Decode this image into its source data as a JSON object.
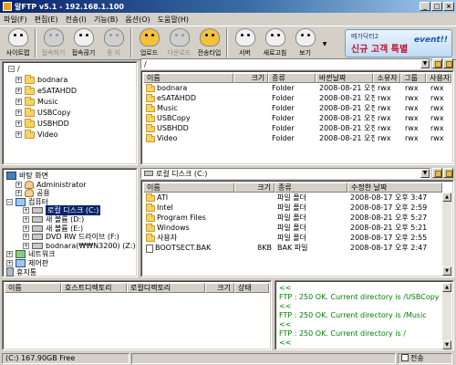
{
  "window": {
    "title": "알FTP v5.1 - 192.168.1.100"
  },
  "menu": [
    "파일(F)",
    "편집(E)",
    "전송(I)",
    "기능(B)",
    "옵션(O)",
    "도움말(H)"
  ],
  "toolbar": {
    "buttons": [
      {
        "label": "사이트맵",
        "color": "#f0f0f0",
        "enabled": true
      },
      {
        "label": "접속하기",
        "color": "#cfcfcf",
        "enabled": false
      },
      {
        "label": "접속끊기",
        "color": "#f0f0f0",
        "enabled": true
      },
      {
        "label": "중 지",
        "color": "#cfcfcf",
        "enabled": false
      },
      {
        "label": "업로드",
        "color": "#f3c13a",
        "enabled": true
      },
      {
        "label": "다운로드",
        "color": "#cfcfcf",
        "enabled": false
      },
      {
        "label": "전송타입",
        "color": "#f3c13a",
        "enabled": true
      },
      {
        "label": "서버",
        "color": "#f0f0f0",
        "enabled": true
      },
      {
        "label": "새로고침",
        "color": "#f0f0f0",
        "enabled": true
      },
      {
        "label": "보기",
        "color": "#f0f0f0",
        "enabled": true
      }
    ],
    "ad": {
      "top": "메가닥터2",
      "main": "신규 고객 특별",
      "event": "event!!"
    }
  },
  "remote_tree": {
    "items": [
      "/",
      "bodnara",
      "eSATAHDD",
      "Music",
      "USBCopy",
      "USBHDD",
      "Video"
    ]
  },
  "remote": {
    "path": "/",
    "columns": [
      "이름",
      "크기",
      "종류",
      "바뀐날짜",
      "소유자",
      "그룹",
      "사용자"
    ],
    "rows": [
      {
        "name": "bodnara",
        "size": "",
        "type": "Folder",
        "date": "2008-08-21 오전 ...",
        "owner": "rwx",
        "group": "rwx",
        "user": "rwx"
      },
      {
        "name": "eSATAHDD",
        "size": "",
        "type": "Folder",
        "date": "2008-08-21 오전 ...",
        "owner": "rwx",
        "group": "rwx",
        "user": "rwx"
      },
      {
        "name": "Music",
        "size": "",
        "type": "Folder",
        "date": "2008-08-21 오전 ...",
        "owner": "rwx",
        "group": "rwx",
        "user": "rwx"
      },
      {
        "name": "USBCopy",
        "size": "",
        "type": "Folder",
        "date": "2008-08-21 오전 ...",
        "owner": "rwx",
        "group": "rwx",
        "user": "rwx"
      },
      {
        "name": "USBHDD",
        "size": "",
        "type": "Folder",
        "date": "2008-08-21 오전 ...",
        "owner": "rwx",
        "group": "rwx",
        "user": "rwx"
      },
      {
        "name": "Video",
        "size": "",
        "type": "Folder",
        "date": "2008-08-21 오전 ...",
        "owner": "rwx",
        "group": "rwx",
        "user": "rwx"
      }
    ]
  },
  "local_tree": {
    "items": [
      {
        "label": "바탕 화면",
        "icon": "desk"
      },
      {
        "label": "Administrator",
        "icon": "user"
      },
      {
        "label": "공용",
        "icon": "user"
      },
      {
        "label": "컴퓨터",
        "icon": "pc"
      },
      {
        "label": "로컬 디스크 (C:)",
        "icon": "drive",
        "selected": true
      },
      {
        "label": "새 볼륨 (D:)",
        "icon": "drive"
      },
      {
        "label": "새 볼륨 (E:)",
        "icon": "drive"
      },
      {
        "label": "DVD RW 드라이브 (F:)",
        "icon": "drive"
      },
      {
        "label": "bodnara(₩₩N3200) (Z:)",
        "icon": "drive"
      },
      {
        "label": "네트워크",
        "icon": "net"
      },
      {
        "label": "제어판",
        "icon": "pc"
      },
      {
        "label": "휴지통",
        "icon": "trash"
      }
    ]
  },
  "local": {
    "path": "로컬 디스크 (C:)",
    "columns": [
      "이름",
      "크기",
      "종류",
      "수정한 날짜"
    ],
    "rows": [
      {
        "name": "ATI",
        "size": "",
        "type": "파일 폴더",
        "date": "2008-08-17 오후 3:47",
        "icon": "folder"
      },
      {
        "name": "Intel",
        "size": "",
        "type": "파일 폴더",
        "date": "2008-08-17 오후 2:59",
        "icon": "folder"
      },
      {
        "name": "Program Files",
        "size": "",
        "type": "파일 폴더",
        "date": "2008-08-21 오후 5:27",
        "icon": "folder"
      },
      {
        "name": "Windows",
        "size": "",
        "type": "파일 폴더",
        "date": "2008-08-21 오후 5:21",
        "icon": "folder"
      },
      {
        "name": "사용자",
        "size": "",
        "type": "파일 폴더",
        "date": "2008-08-17 오후 2:55",
        "icon": "folder"
      },
      {
        "name": "BOOTSECT.BAK",
        "size": "8KB",
        "type": "BAK 파일",
        "date": "2008-08-17 오후 2:47",
        "icon": "file"
      }
    ]
  },
  "queue": {
    "columns": [
      "이름",
      "호스트디렉토리",
      "로컬디렉토리",
      "크기",
      "상태"
    ]
  },
  "log": {
    "lines": [
      "<<",
      "FTP : 250 OK. Current directory is /USBCopy",
      "<<",
      "FTP : 250 OK. Current directory is /Music",
      "<<",
      "FTP : 250 OK. Current directory is /",
      "<<"
    ]
  },
  "status": {
    "drive": "(C:)  167.90GB Free",
    "check_label": "전송"
  },
  "colors": {
    "selection": "#0a246a",
    "log_text": "#008000",
    "title_start": "#0a246a"
  }
}
